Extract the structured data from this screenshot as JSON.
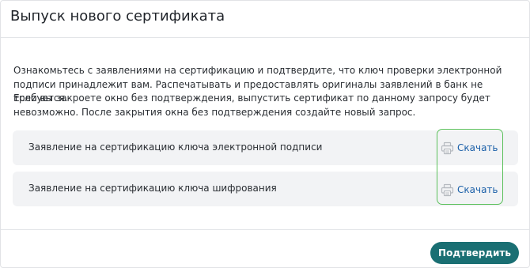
{
  "dialog": {
    "title": "Выпуск нового сертификата",
    "paragraph1": "Ознакомьтесь с заявлениями на сертификацию и подтвердите, что ключ проверки электронной подписи принадлежит вам. Распечатывать и предоставлять оригиналы заявлений в банк не требуется.",
    "paragraph2": "Если вы закроете окно без подтверждения, выпустить сертификат по данному запросу будет невозможно. После закрытия окна без подтверждения создайте новый запрос."
  },
  "documents": [
    {
      "label": "Заявление на сертификацию ключа электронной подписи",
      "download_label": "Скачать",
      "icon": "printer-icon"
    },
    {
      "label": "Заявление на сертификацию ключа шифрования",
      "download_label": "Скачать",
      "icon": "printer-icon"
    }
  ],
  "footer": {
    "confirm_label": "Подтвердить"
  },
  "colors": {
    "accent": "#1a6f73",
    "link": "#1a5fa8",
    "highlight": "#5cc15c",
    "row_background": "#f2f3f5"
  }
}
